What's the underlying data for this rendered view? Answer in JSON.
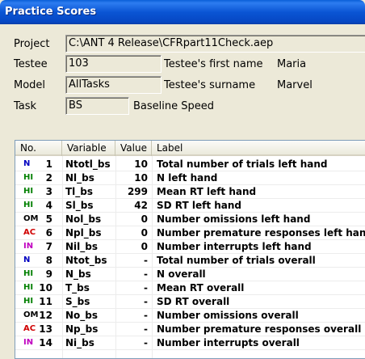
{
  "window": {
    "title": "Practice Scores"
  },
  "form": {
    "project_label": "Project",
    "project_value": "C:\\ANT 4 Release\\CFRpart11Check.aep",
    "testee_label": "Testee",
    "testee_value": "103",
    "first_name_label": "Testee's first name",
    "first_name_value": "Maria",
    "model_label": "Model",
    "model_value": "AllTasks",
    "surname_label": "Testee's surname",
    "surname_value": "Marvel",
    "task_label": "Task",
    "task_value": "BS",
    "task_desc": "Baseline Speed"
  },
  "table": {
    "columns": [
      "No.",
      "Variable",
      "Value",
      "Label"
    ],
    "rows": [
      {
        "badge": "N",
        "badge_color": "#0000c0",
        "no": "1",
        "variable": "Ntotl_bs",
        "value": "10",
        "label": "Total number of trials left hand"
      },
      {
        "badge": "HI",
        "badge_color": "#008000",
        "no": "2",
        "variable": "Nl_bs",
        "value": "10",
        "label": "N left hand"
      },
      {
        "badge": "HI",
        "badge_color": "#008000",
        "no": "3",
        "variable": "Tl_bs",
        "value": "299",
        "label": "Mean RT left hand"
      },
      {
        "badge": "HI",
        "badge_color": "#008000",
        "no": "4",
        "variable": "Sl_bs",
        "value": "42",
        "label": "SD RT left hand"
      },
      {
        "badge": "OM",
        "badge_color": "#000000",
        "no": "5",
        "variable": "Nol_bs",
        "value": "0",
        "label": "Number omissions left hand"
      },
      {
        "badge": "AC",
        "badge_color": "#d00000",
        "no": "6",
        "variable": "Npl_bs",
        "value": "0",
        "label": "Number premature responses left hand"
      },
      {
        "badge": "IN",
        "badge_color": "#c000c0",
        "no": "7",
        "variable": "Nil_bs",
        "value": "0",
        "label": "Number interrupts left hand"
      },
      {
        "badge": "N",
        "badge_color": "#0000c0",
        "no": "8",
        "variable": "Ntot_bs",
        "value": "-",
        "label": "Total number of trials overall"
      },
      {
        "badge": "HI",
        "badge_color": "#008000",
        "no": "9",
        "variable": "N_bs",
        "value": "-",
        "label": "N overall"
      },
      {
        "badge": "HI",
        "badge_color": "#008000",
        "no": "10",
        "variable": "T_bs",
        "value": "-",
        "label": "Mean RT overall"
      },
      {
        "badge": "HI",
        "badge_color": "#008000",
        "no": "11",
        "variable": "S_bs",
        "value": "-",
        "label": "SD RT overall"
      },
      {
        "badge": "OM",
        "badge_color": "#000000",
        "no": "12",
        "variable": "No_bs",
        "value": "-",
        "label": "Number omissions overall"
      },
      {
        "badge": "AC",
        "badge_color": "#d00000",
        "no": "13",
        "variable": "Np_bs",
        "value": "-",
        "label": "Number premature responses overall"
      },
      {
        "badge": "IN",
        "badge_color": "#c000c0",
        "no": "14",
        "variable": "Ni_bs",
        "value": "-",
        "label": "Number interrupts overall"
      }
    ]
  }
}
